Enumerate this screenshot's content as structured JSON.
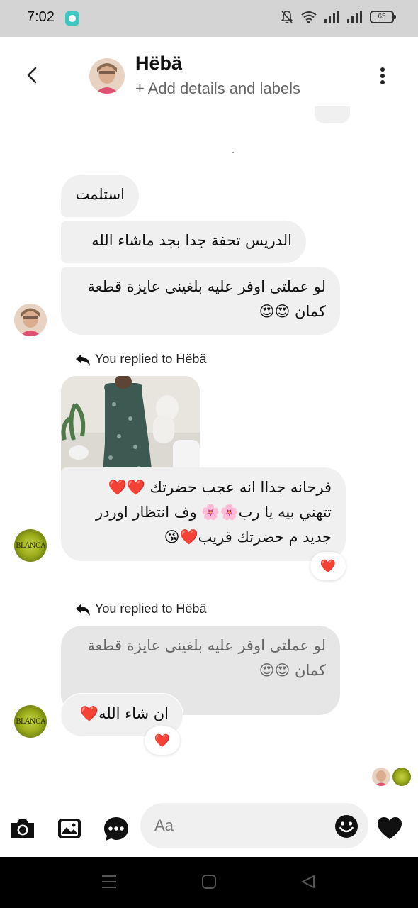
{
  "status_bar": {
    "time": "7:02",
    "battery": "65"
  },
  "header": {
    "name": "Hëbä",
    "subtitle": "+ Add details and labels"
  },
  "messages": {
    "m1": "استلمت",
    "m2": "الدريس تحفة جدا بجد ماشاء الله",
    "m3_line1": "لو عملتى اوفر عليه بلغينى عايزة قطعة",
    "m3_line2": "كمان 😍😍",
    "reply_note_1": "You replied to Hëbä",
    "m4_line1": "فرحانه جداا انه عجب حضرتك ❤️❤️",
    "m4_line2": "تتهني بيه يا رب🌸🌸 وف انتظار اوردر",
    "m4_line3": "جديد م حضرتك قريب❤️😘",
    "reaction_1": "❤️",
    "reply_note_2": "You replied to Hëbä",
    "quoted_line1": "لو عملتى اوفر عليه بلغينى عايزة قطعة",
    "quoted_line2": "كمان 😍😍",
    "m5": "ان شاء الله❤️",
    "reaction_2": "❤️"
  },
  "avatars": {
    "blanca_label": "BLANCA"
  },
  "composer": {
    "placeholder": "Aa"
  },
  "colors": {
    "bubble": "#f0f0f0",
    "quoted_bubble": "#e6e6e6",
    "status_bar": "#d4d4d4",
    "nav_bar": "#000000"
  }
}
